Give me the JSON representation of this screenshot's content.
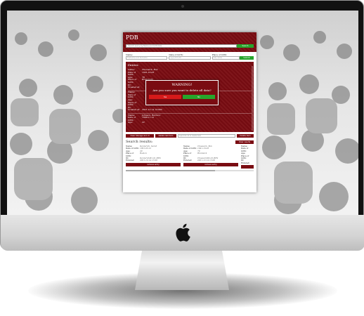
{
  "app": {
    "title": "PDB",
    "search": {
      "placeholder": "Search query by Name and birthdate",
      "button": "Search"
    },
    "form": {
      "name_label": "Name:",
      "name_placeholder": "Firstname and Surname",
      "dob_label": "Date of birth:",
      "dob_placeholder": "yyyy-mm-dd",
      "pob_label": "Place of birth:",
      "pob_placeholder": "City name",
      "submit": "Submit"
    },
    "entries": {
      "title": "Entries",
      "items": [
        {
          "name_k": "Name:",
          "name": "Chuswick, Bob",
          "dob_k": "Date of birth:",
          "dob": "1941-10-03",
          "age_k": "Age:",
          "age": "78",
          "pob_k": "Place of birth:",
          "pob": "Bradsmith",
          "id_k": "ID:",
          "id": "",
          "created_k": "Created at:",
          "created": ""
        },
        {
          "name_k": "Name:",
          "name": "",
          "dob_k": "Date of birth:",
          "dob": "",
          "age_k": "Age:",
          "age": "",
          "pob_k": "Place of birth:",
          "pob": "",
          "id_k": "ID:",
          "id": "",
          "created_k": "Created at:",
          "created": "2021-12-14 13:00h"
        },
        {
          "name_k": "Name:",
          "name": "Johnson, Barbara",
          "dob_k": "Date of birth:",
          "dob": "1999-11-12",
          "age_k": "Age:",
          "age": "22",
          "pob_k": "",
          "pob": "",
          "id_k": "",
          "id": "",
          "created_k": "",
          "created": ""
        }
      ]
    },
    "warning": {
      "title": "WARNING!",
      "text": "Are you sure you want to delete all data?",
      "yes": "Yes",
      "no": "No"
    },
    "actions": {
      "clear_storage": "Clear Storage and UI",
      "delete_last": "Delete last item",
      "delete_id_placeholder": "Searchfor ID to delete item",
      "delete_item": "Delete item"
    },
    "results": {
      "title": "Search results:",
      "clear_button": "Clear results",
      "items": [
        {
          "name_k": "Name:",
          "name": "Denterich, Sarah",
          "dob_k": "Date of birth:",
          "dob": "1991-03-12",
          "age_k": "Age:",
          "age": "29",
          "pob_k": "Place of birth:",
          "pob": "Boston",
          "id_k": "ID:",
          "id": "Denterich#1-01-BES",
          "entered_k": "Entered:",
          "entered": "2021-12-14 13:00",
          "remove": "remove entry"
        },
        {
          "name_k": "Name:",
          "name": "Chuswick, Bob",
          "dob_k": "Date of birth:",
          "dob": "1941-10-03",
          "age_k": "Age:",
          "age": "79",
          "pob_k": "Place of birth:",
          "pob": "Bradwick",
          "id_k": "ID:",
          "id": "Chuswick#2-01-BES",
          "entered_k": "Entered:",
          "entered": "2021-12-14 13:00",
          "remove": "remove entry"
        },
        {
          "name_k": "Name:",
          "dob_k": "Date of birth:",
          "age_k": "Age:",
          "pob_k": "Place of birth:",
          "id_k": "ID:",
          "entered_k": "Entered:"
        }
      ]
    }
  },
  "colors": {
    "brand": "#7a0c12",
    "confirm": "#27a52b",
    "danger": "#d61a1a"
  },
  "icons": {
    "logo": "apple-logo-icon"
  }
}
